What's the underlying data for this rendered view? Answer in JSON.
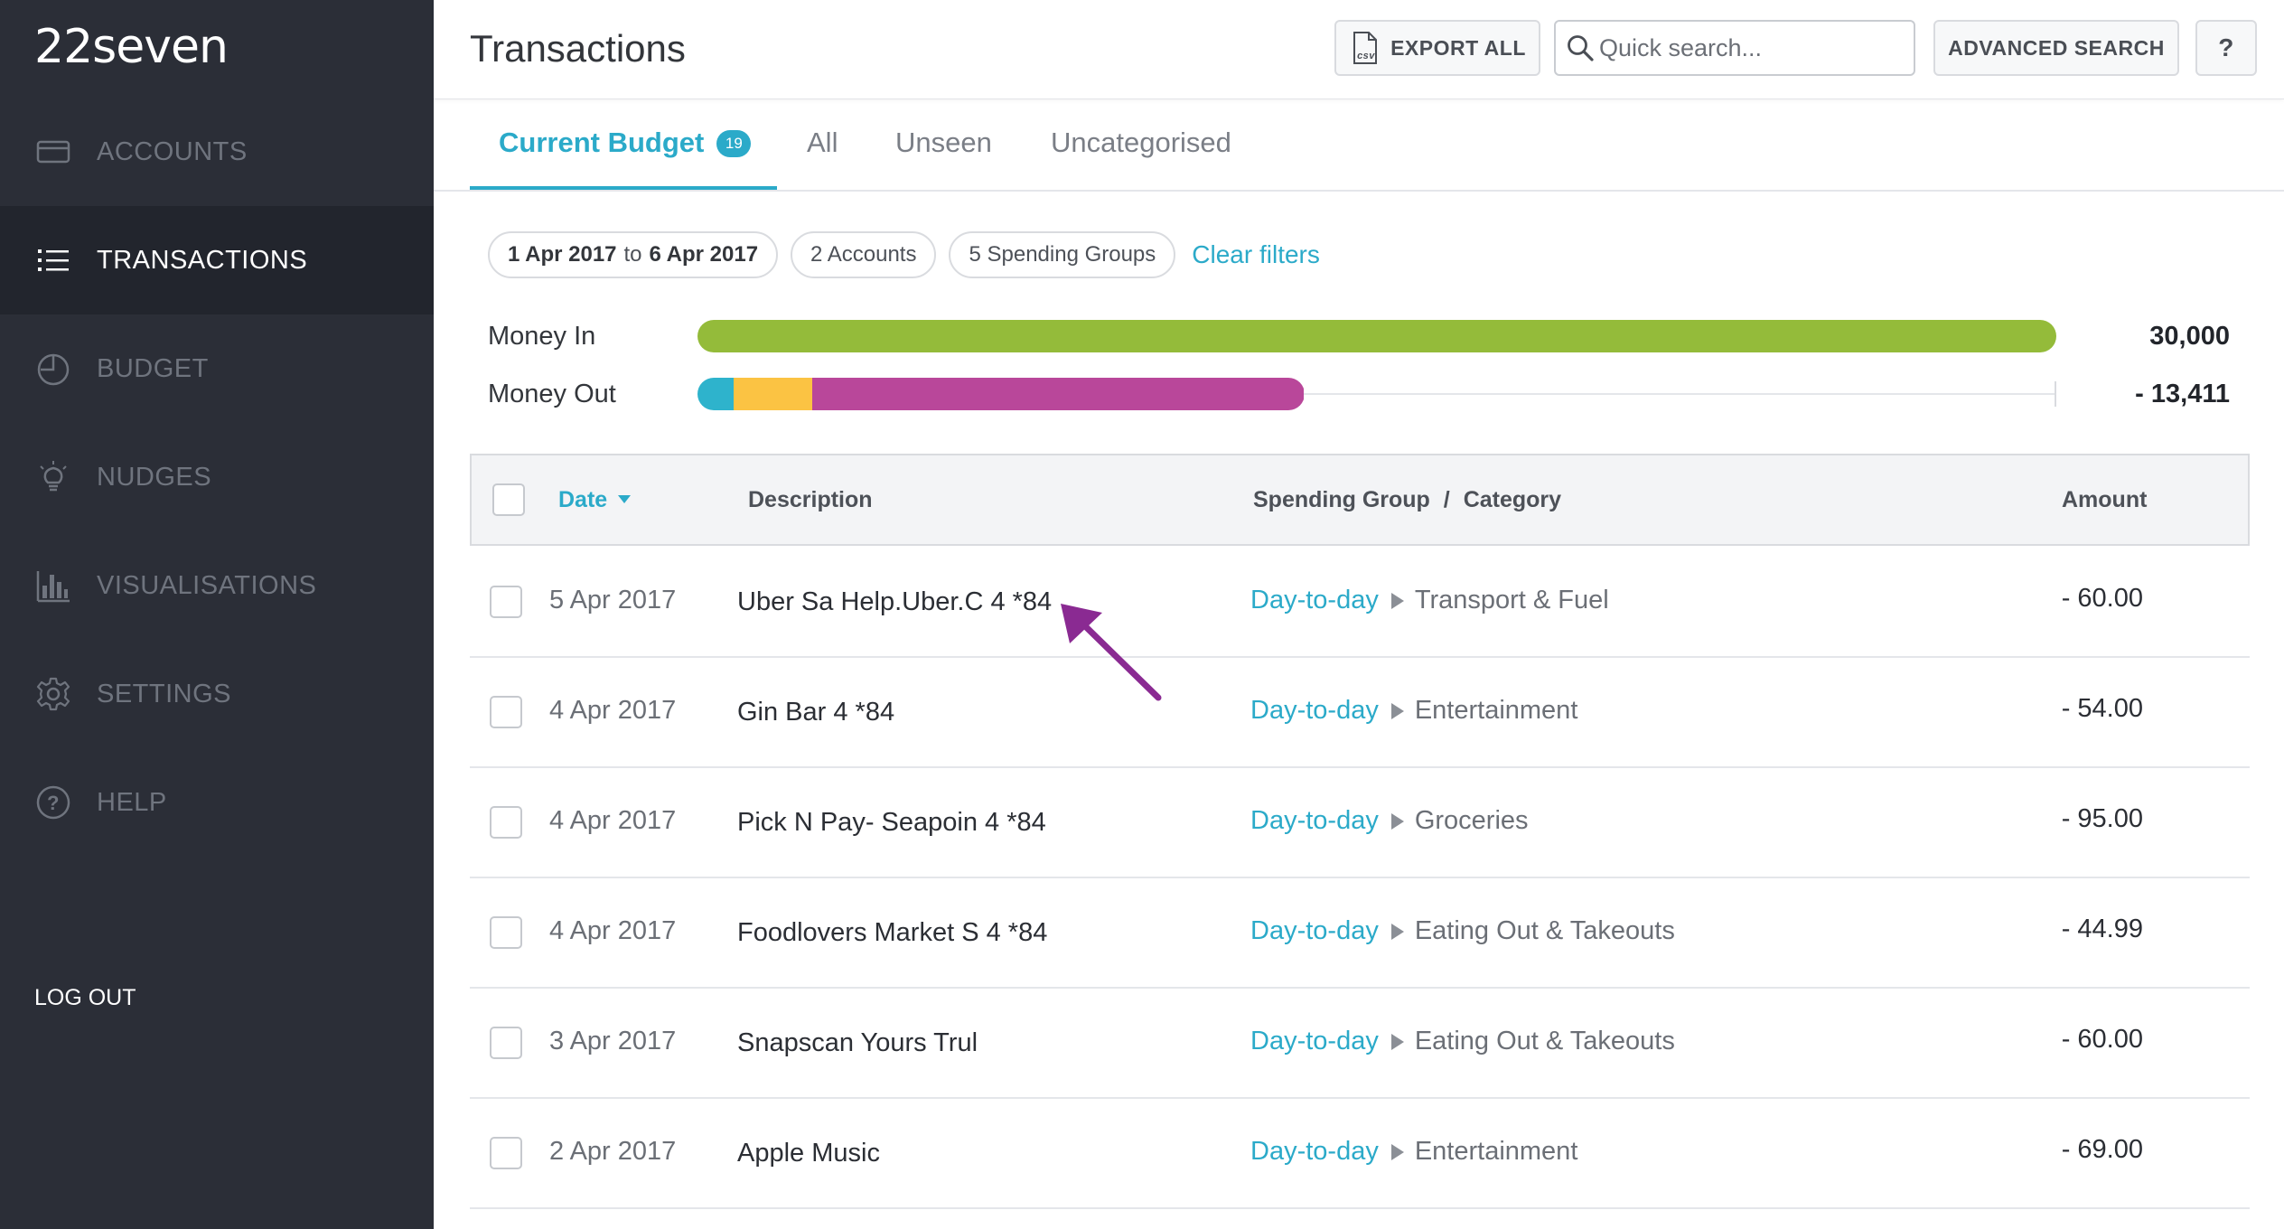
{
  "app": {
    "logo": "22seven"
  },
  "sidebar": {
    "items": [
      {
        "label": "ACCOUNTS",
        "icon": "card-icon"
      },
      {
        "label": "TRANSACTIONS",
        "icon": "list-icon",
        "active": true
      },
      {
        "label": "BUDGET",
        "icon": "pie-chart-icon"
      },
      {
        "label": "NUDGES",
        "icon": "lightbulb-icon"
      },
      {
        "label": "VISUALISATIONS",
        "icon": "bar-chart-icon"
      },
      {
        "label": "SETTINGS",
        "icon": "gear-icon"
      },
      {
        "label": "HELP",
        "icon": "question-circle-icon"
      }
    ],
    "logout_label": "LOG OUT"
  },
  "header": {
    "title": "Transactions",
    "export_label": "EXPORT ALL",
    "search_placeholder": "Quick search...",
    "advanced_label": "ADVANCED SEARCH",
    "help_label": "?"
  },
  "tabs": {
    "items": [
      {
        "label": "Current Budget",
        "badge": "19",
        "active": true
      },
      {
        "label": "All"
      },
      {
        "label": "Unseen"
      },
      {
        "label": "Uncategorised"
      }
    ]
  },
  "filters": {
    "date_from": "1 Apr 2017",
    "date_to_word": "to",
    "date_to": "6 Apr 2017",
    "accounts": "2 Accounts",
    "spending_groups": "5 Spending Groups",
    "clear_label": "Clear filters"
  },
  "money": {
    "in_label": "Money In",
    "in_value": "30,000",
    "in_fraction": 1.0,
    "out_label": "Money Out",
    "out_value": "- 13,411",
    "out_fraction": 0.447,
    "out_segments": [
      {
        "share": 0.06,
        "color": "#2eb3cc"
      },
      {
        "share": 0.13,
        "color": "#fbc343"
      },
      {
        "share": 0.81,
        "color": "#b9479a"
      }
    ],
    "in_color": "#94bb3a"
  },
  "table": {
    "headers": {
      "date": "Date",
      "description": "Description",
      "group": "Spending Group",
      "separator": "/",
      "category": "Category",
      "amount": "Amount"
    },
    "rows": [
      {
        "date": "5 Apr 2017",
        "description": "Uber Sa Help.Uber.C 4 *84",
        "group": "Day-to-day",
        "category": "Transport & Fuel",
        "amount": "- 60.00"
      },
      {
        "date": "4 Apr 2017",
        "description": "Gin Bar 4 *84",
        "group": "Day-to-day",
        "category": "Entertainment",
        "amount": "- 54.00"
      },
      {
        "date": "4 Apr 2017",
        "description": "Pick N Pay- Seapoin 4 *84",
        "group": "Day-to-day",
        "category": "Groceries",
        "amount": "- 95.00"
      },
      {
        "date": "4 Apr 2017",
        "description": "Foodlovers Market S 4 *84",
        "group": "Day-to-day",
        "category": "Eating Out & Takeouts",
        "amount": "- 44.99"
      },
      {
        "date": "3 Apr 2017",
        "description": "Snapscan Yours Trul",
        "group": "Day-to-day",
        "category": "Eating Out & Takeouts",
        "amount": "- 60.00"
      },
      {
        "date": "2 Apr 2017",
        "description": "Apple Music",
        "group": "Day-to-day",
        "category": "Entertainment",
        "amount": "- 69.00"
      }
    ]
  },
  "colors": {
    "accent": "#2baac9",
    "sidebar_bg": "#2b2e37",
    "annotation_arrow": "#8a2a92"
  }
}
